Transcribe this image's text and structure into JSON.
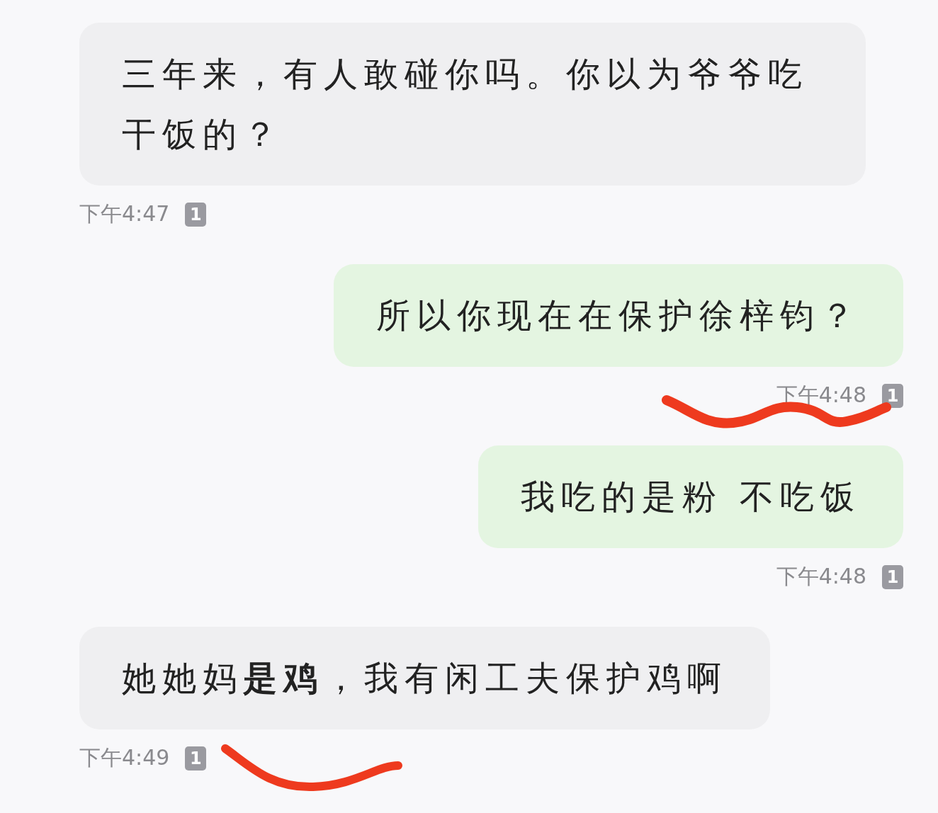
{
  "messages": [
    {
      "kind": "received",
      "text": "三年来，有人敢碰你吗。你以为爷爷吃干饭的？",
      "time": "下午4:47",
      "read_count": "1"
    },
    {
      "kind": "sent",
      "text": "所以你现在在保护徐梓钧？",
      "time": "下午4:48",
      "read_count": "1",
      "overlay": {
        "kind": "scribble"
      }
    },
    {
      "kind": "sent",
      "text": "我吃的是粉 不吃饭",
      "time": "下午4:48",
      "read_count": "1"
    },
    {
      "kind": "received",
      "text": "她她妈**是鸡**，我有闲工夫保护鸡啊",
      "time": "下午4:49",
      "read_count": "1",
      "overlay": {
        "kind": "scribble"
      }
    }
  ]
}
